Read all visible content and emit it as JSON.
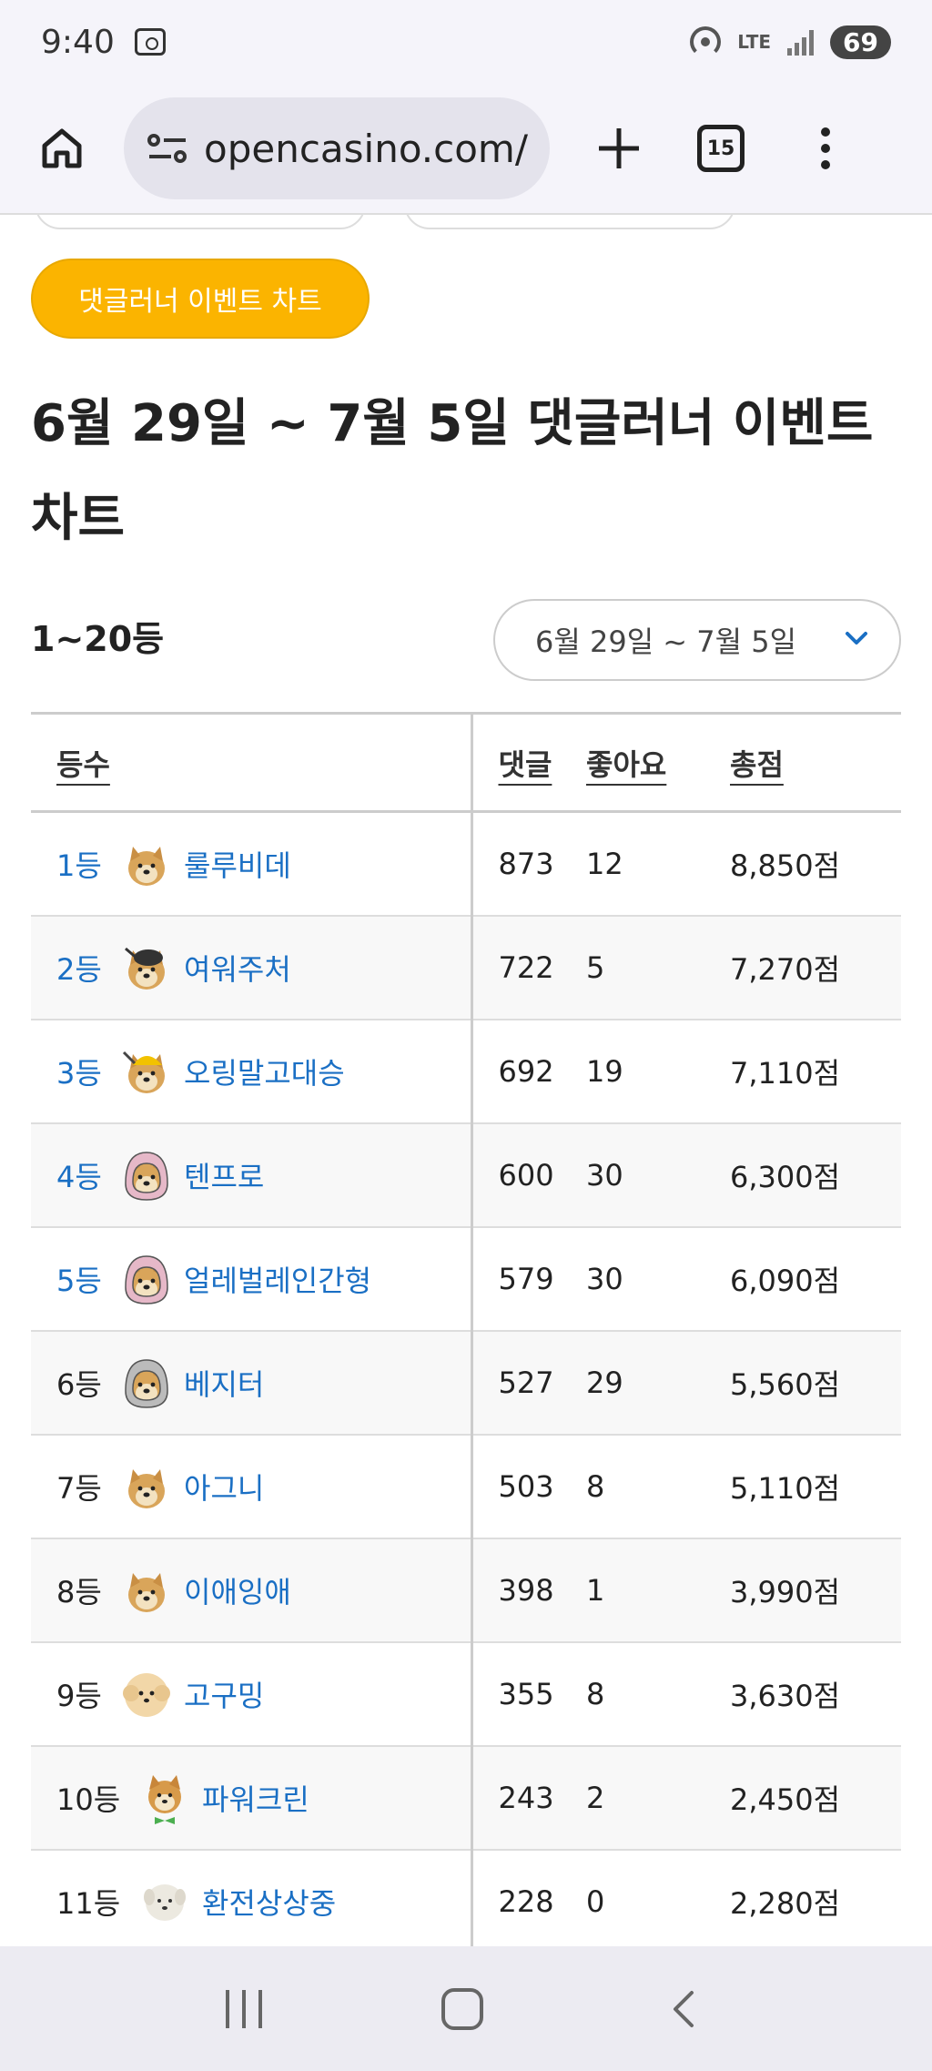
{
  "status_bar": {
    "time": "9:40",
    "network": "LTE",
    "battery": "69"
  },
  "browser": {
    "url": "opencasino.com/",
    "tab_count": "15"
  },
  "page": {
    "event_button": "댓글러너 이벤트 차트",
    "title": "6월 29일 ~ 7월 5일 댓글러너 이벤트 차트",
    "rank_range": "1~20등",
    "date_select": "6월 29일 ~ 7월 5일"
  },
  "table": {
    "headers": {
      "rank": "등수",
      "comments": "댓글",
      "likes": "좋아요",
      "score": "총점"
    },
    "rows": [
      {
        "rank": "1등",
        "nick": "룰루비데",
        "comments": "873",
        "likes": "12",
        "score": "8,850점",
        "avatar": "doge"
      },
      {
        "rank": "2등",
        "nick": "여워주처",
        "comments": "722",
        "likes": "5",
        "score": "7,270점",
        "avatar": "doge-black-hat"
      },
      {
        "rank": "3등",
        "nick": "오링말고대승",
        "comments": "692",
        "likes": "19",
        "score": "7,110점",
        "avatar": "doge-yellow-helmet"
      },
      {
        "rank": "4등",
        "nick": "텐프로",
        "comments": "600",
        "likes": "30",
        "score": "6,300점",
        "avatar": "doge-pink-hood"
      },
      {
        "rank": "5등",
        "nick": "얼레벌레인간형",
        "comments": "579",
        "likes": "30",
        "score": "6,090점",
        "avatar": "doge-pink-hood"
      },
      {
        "rank": "6등",
        "nick": "베지터",
        "comments": "527",
        "likes": "29",
        "score": "5,560점",
        "avatar": "doge-grey-helmet"
      },
      {
        "rank": "7등",
        "nick": "아그니",
        "comments": "503",
        "likes": "8",
        "score": "5,110점",
        "avatar": "doge"
      },
      {
        "rank": "8등",
        "nick": "이애잉애",
        "comments": "398",
        "likes": "1",
        "score": "3,990점",
        "avatar": "doge"
      },
      {
        "rank": "9등",
        "nick": "고구밍",
        "comments": "355",
        "likes": "8",
        "score": "3,630점",
        "avatar": "poodle"
      },
      {
        "rank": "10등",
        "nick": "파워크린",
        "comments": "243",
        "likes": "2",
        "score": "2,450점",
        "avatar": "shiba-bowtie"
      },
      {
        "rank": "11등",
        "nick": "환전상상중",
        "comments": "228",
        "likes": "0",
        "score": "2,280점",
        "avatar": "white-puppy"
      }
    ]
  },
  "colors": {
    "accent_link": "#1a6fc4",
    "event_button": "#fbb400"
  }
}
